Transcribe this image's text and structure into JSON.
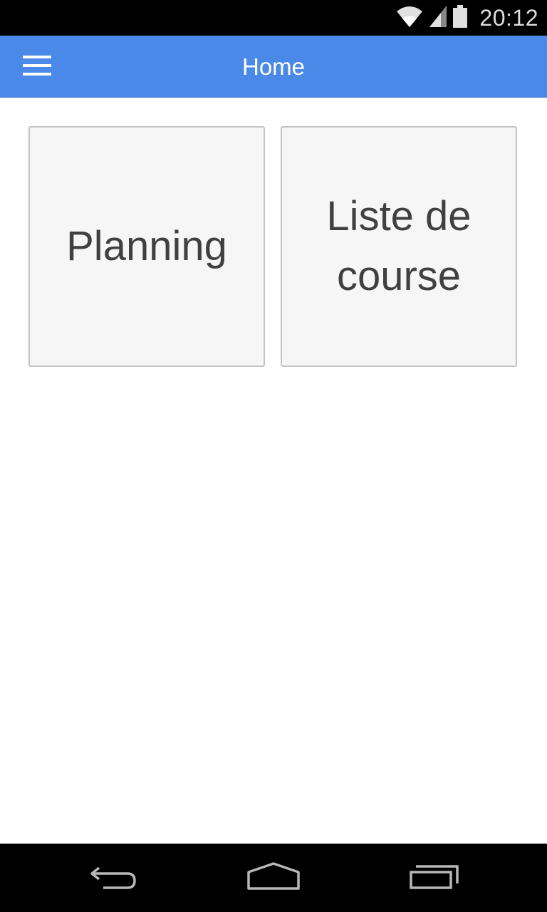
{
  "status_bar": {
    "time": "20:12",
    "icons": [
      "wifi-icon",
      "cell-signal-icon",
      "battery-icon"
    ]
  },
  "app_bar": {
    "title": "Home",
    "menu_icon": "hamburger-menu-icon",
    "background_color": "#4a89e8"
  },
  "tiles": [
    {
      "label": "Planning"
    },
    {
      "label": "Liste de course"
    }
  ],
  "nav_bar": {
    "buttons": [
      "back-icon",
      "home-icon",
      "recent-apps-icon"
    ]
  }
}
